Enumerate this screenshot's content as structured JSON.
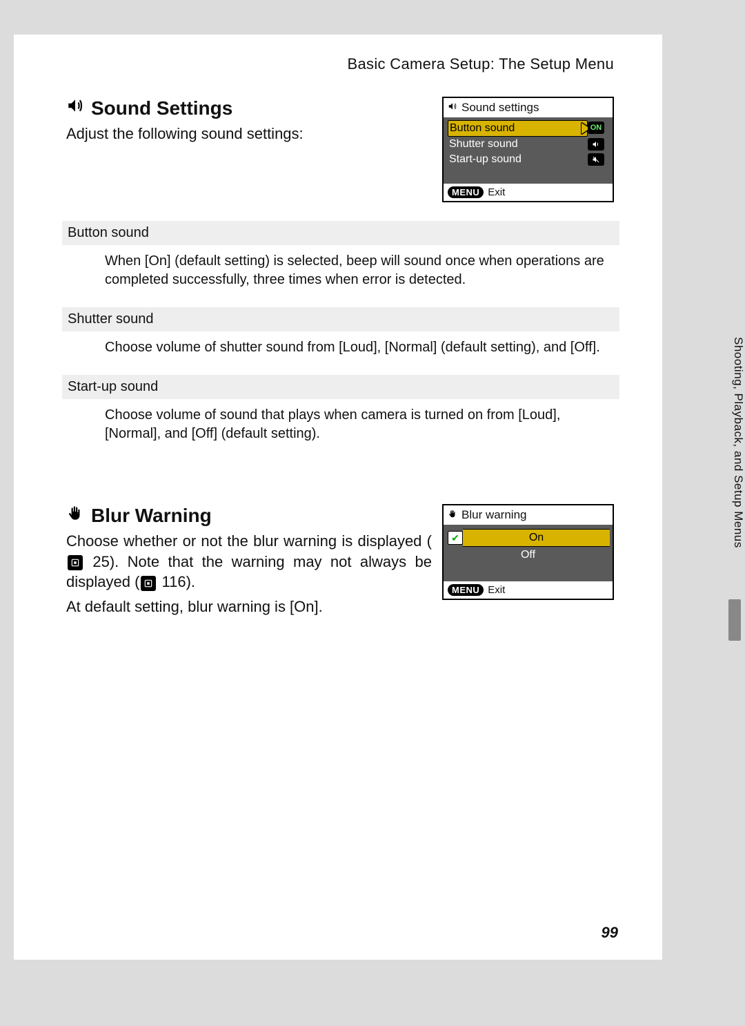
{
  "header": {
    "title": "Basic Camera Setup: The Setup Menu"
  },
  "section1": {
    "title": "Sound Settings",
    "subtitle": "Adjust the following sound settings:"
  },
  "lcd1": {
    "title": "Sound settings",
    "items": [
      {
        "label": "Button sound",
        "badge": "ON"
      },
      {
        "label": "Shutter sound",
        "badge": "speaker"
      },
      {
        "label": "Start-up sound",
        "badge": "speaker-off"
      }
    ],
    "menu_label": "MENU",
    "exit_label": "Exit"
  },
  "options": [
    {
      "title": "Button sound",
      "body": "When [On] (default setting) is selected, beep will sound once when operations are completed successfully, three times when error is detected."
    },
    {
      "title": "Shutter sound",
      "body": "Choose volume of shutter sound from [Loud], [Normal] (default setting), and [Off]."
    },
    {
      "title": "Start-up sound",
      "body": "Choose volume of sound that plays when camera is turned on from [Loud], [Normal], and [Off] (default setting)."
    }
  ],
  "section2": {
    "title": "Blur Warning",
    "body_pre": "Choose whether or not the blur warning is displayed (",
    "body_mid1": " 25). Note that the warning may not always be displayed (",
    "body_mid2": " 116).",
    "body_default": "At default setting, blur warning is [On]."
  },
  "lcd2": {
    "title": "Blur warning",
    "on": "On",
    "off": "Off",
    "menu_label": "MENU",
    "exit_label": "Exit"
  },
  "side_tab": "Shooting, Playback, and Setup Menus",
  "page_num": "99"
}
